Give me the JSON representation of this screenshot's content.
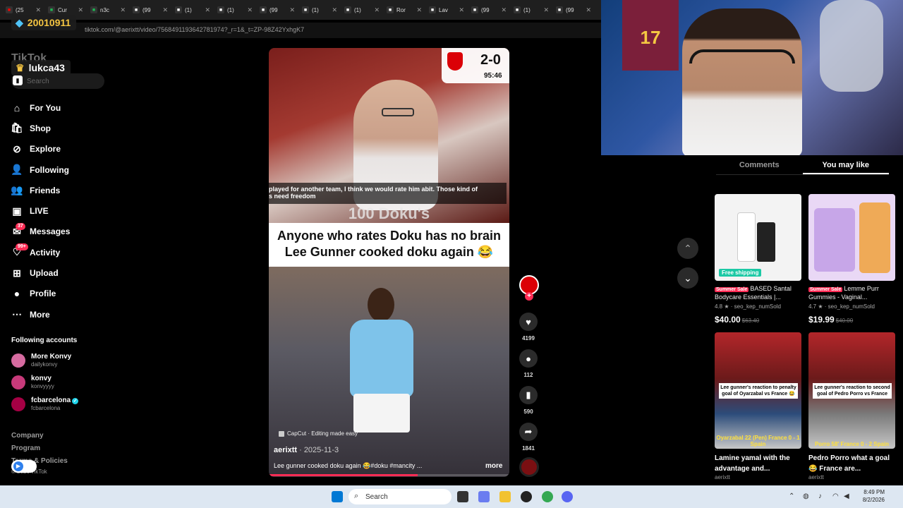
{
  "browser": {
    "tabs": [
      {
        "icon": "youtube-icon",
        "label": "(25",
        "color": "#ff0000"
      },
      {
        "icon": "sheet-icon",
        "label": "Cur",
        "color": "#1db954"
      },
      {
        "icon": "sheet-icon",
        "label": "n3c",
        "color": "#1db954"
      },
      {
        "icon": "tiktok-icon",
        "label": "(99",
        "color": "#ffffff"
      },
      {
        "icon": "x-icon",
        "label": "(1)",
        "color": "#ffffff"
      },
      {
        "icon": "x-icon",
        "label": "(1)",
        "color": "#ffffff"
      },
      {
        "icon": "tiktok-icon",
        "label": "(99",
        "color": "#ffffff"
      },
      {
        "icon": "x-icon",
        "label": "(1)",
        "color": "#ffffff"
      },
      {
        "icon": "x-icon",
        "label": "(1)",
        "color": "#ffffff"
      },
      {
        "icon": "tiktok-icon",
        "label": "Ror",
        "color": "#ffffff"
      },
      {
        "icon": "tiktok-icon",
        "label": "Lav",
        "color": "#ffffff"
      },
      {
        "icon": "tiktok-icon",
        "label": "(99",
        "color": "#ffffff"
      },
      {
        "icon": "x-icon",
        "label": "(1)",
        "color": "#ffffff"
      },
      {
        "icon": "tiktok-icon",
        "label": "(99",
        "color": "#ffffff"
      }
    ],
    "url": "tiktok.com/@aerixtt/video/7568491193642781974?_r=1&_t=ZP-98Z42YxhgK7"
  },
  "overlay": {
    "coins": "20010911",
    "username": "lukca43"
  },
  "sidebar": {
    "logo": "TikTok",
    "search_placeholder": "Search",
    "items": [
      {
        "label": "For You",
        "icon": "home-icon",
        "glyph": "⌂"
      },
      {
        "label": "Shop",
        "icon": "shop-icon",
        "glyph": "🛍"
      },
      {
        "label": "Explore",
        "icon": "compass-icon",
        "glyph": "⊘"
      },
      {
        "label": "Following",
        "icon": "following-icon",
        "glyph": "👤"
      },
      {
        "label": "Friends",
        "icon": "friends-icon",
        "glyph": "👥"
      },
      {
        "label": "LIVE",
        "icon": "live-icon",
        "glyph": "▣"
      },
      {
        "label": "Messages",
        "icon": "messages-icon",
        "glyph": "✉",
        "badge": "37"
      },
      {
        "label": "Activity",
        "icon": "activity-icon",
        "glyph": "♡",
        "badge": "99+"
      },
      {
        "label": "Upload",
        "icon": "upload-icon",
        "glyph": "⊞"
      },
      {
        "label": "Profile",
        "icon": "profile-icon",
        "glyph": "●"
      },
      {
        "label": "More",
        "icon": "more-icon",
        "glyph": "⋯"
      }
    ],
    "following_title": "Following accounts",
    "accounts": [
      {
        "name": "More Konvy",
        "handle": "dailykonvy",
        "color": "#d66ba0"
      },
      {
        "name": "konvy",
        "handle": "konvyyyy",
        "color": "#c73a7a"
      },
      {
        "name": "fcbarcelona",
        "handle": "fcbarcelona",
        "color": "#a50044",
        "verified": true
      }
    ],
    "footer": [
      "Company",
      "Program",
      "Terms & Policies",
      "© 2026 TikTok"
    ]
  },
  "video": {
    "score": "2-0",
    "clock": "95:46",
    "caption_line1": "played for another team, I think we would rate him abit. Those kind of",
    "caption_line2": "s need freedom",
    "overlay_text": "100 Doku's",
    "headline_line1": "Anyone who rates Doku has no brain",
    "headline_line2": "Lee Gunner cooked doku again 😂",
    "capcut": "CapCut · Editing made easy",
    "author": "aerixtt",
    "date": "· 2025-11-3",
    "description": "Lee gunner cooked doku again 😂#doku #mancity ...",
    "more": "more",
    "progress": 0.62
  },
  "actions": {
    "likes": "4199",
    "comments": "112",
    "saves": "590",
    "shares": "1841"
  },
  "panel": {
    "tabs": [
      "Comments",
      "You may like"
    ],
    "active_tab": 1,
    "products": [
      {
        "sale": "Summer Sale",
        "title": "BASED Santal Bodycare Essentials |...",
        "rating": "4.8 ★ · seo_kep_numSold",
        "price": "$40.00",
        "old_price": "$63.40",
        "free_shipping": "Free shipping",
        "bg": "#f3f3f3"
      },
      {
        "sale": "Summer Sale",
        "title": "Lemme Purr Gummies - Vaginal...",
        "rating": "4.7 ★ · seo_kep_numSold",
        "price": "$19.99",
        "old_price": "$40.00",
        "bg": "#e9d8f5"
      }
    ],
    "videos": [
      {
        "overlay": "Lee gunner's reaction to penalty goal of Oyarzabal vs France 😂",
        "bottom": "Oyarzabal 22 (Pen) France 0 - 1 Spain",
        "title": "Lamine yamal with the advantage and...",
        "author": "aerixtt"
      },
      {
        "overlay": "Lee gunner's reaction to second goal of Pedro Porro vs France",
        "bottom": "Porro 58' France 0 - 2 Spain",
        "title": "Pedro Porro what a goal😂 France are...",
        "author": "aerixtt"
      }
    ]
  },
  "webcam": {
    "jersey_number": "17"
  },
  "taskbar": {
    "search": "Search",
    "time": "8:49 PM",
    "date": "8/2/2026"
  }
}
